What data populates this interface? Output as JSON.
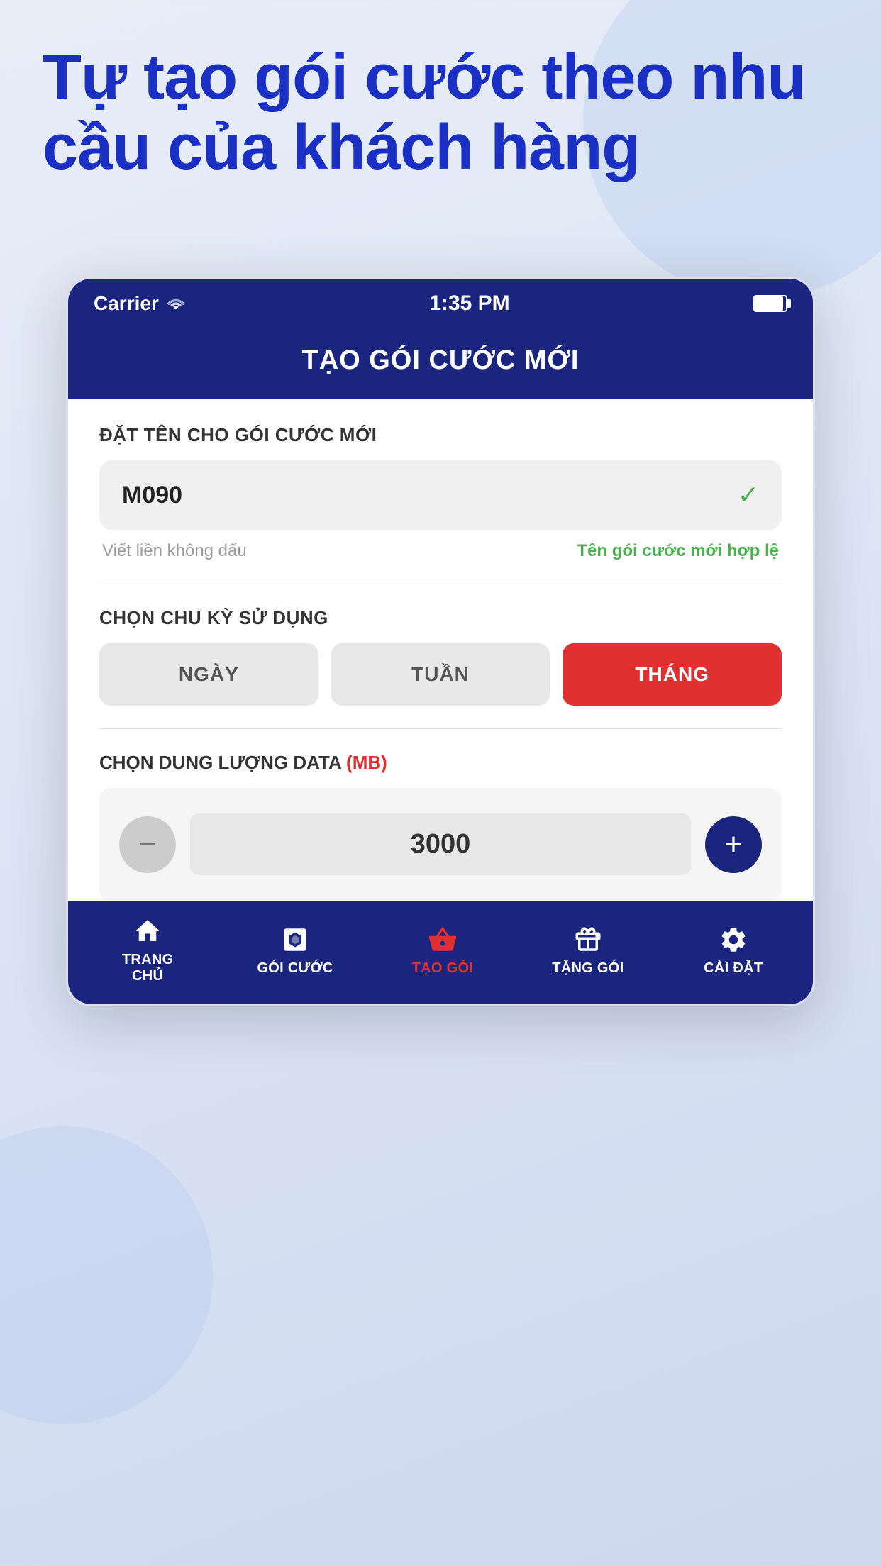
{
  "hero": {
    "title": "Tự tạo gói cước theo nhu cầu của khách hàng"
  },
  "statusBar": {
    "carrier": "Carrier",
    "time": "1:35 PM"
  },
  "appHeader": {
    "title": "TẠO GÓI CƯỚC MỚI"
  },
  "nameSection": {
    "label": "ĐẶT TÊN CHO GÓI CƯỚC MỚI",
    "value": "M090",
    "hint": "Viết liền không dấu",
    "validText": "Tên gói cước mới hợp lệ"
  },
  "cycleSection": {
    "label": "CHỌN CHU KỲ SỬ DỤNG",
    "buttons": [
      {
        "label": "NGÀY",
        "active": false
      },
      {
        "label": "TUẦN",
        "active": false
      },
      {
        "label": "THÁNG",
        "active": true
      }
    ]
  },
  "dataSection": {
    "label": "CHỌN DUNG LƯỢNG DATA",
    "unit": "(MB)",
    "minusLabel": "−",
    "plusLabel": "+",
    "value": "3000"
  },
  "bottomNav": {
    "items": [
      {
        "label": "TRANG\nCHỦ",
        "icon": "🏠",
        "active": false,
        "id": "home"
      },
      {
        "label": "GÓI CƯỚC",
        "icon": "⊞",
        "active": false,
        "id": "packages"
      },
      {
        "label": "TẠO GÓI",
        "icon": "🛒",
        "active": true,
        "id": "create"
      },
      {
        "label": "TẶNG GÓI",
        "icon": "🎁",
        "active": false,
        "id": "gift"
      },
      {
        "label": "CÀI ĐẶT",
        "icon": "⚙",
        "active": false,
        "id": "settings"
      }
    ]
  }
}
